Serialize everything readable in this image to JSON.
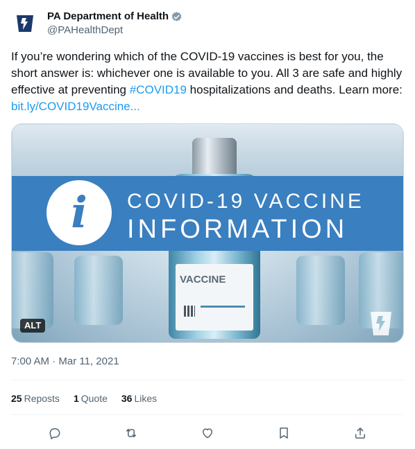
{
  "author": {
    "display_name": "PA Department of Health",
    "handle": "@PAHealthDept",
    "verified": true
  },
  "tweet": {
    "text_before": "If you’re wondering which of the COVID-19 vaccines is best for you, the short answer is: whichever one is available to you. All 3 are safe and highly effective at preventing ",
    "hashtag": "#COVID19",
    "text_after": " hospitalizations and deaths. Learn more: ",
    "link": "bit.ly/COVID19Vaccine..."
  },
  "media": {
    "banner_line1": "COVID-19 VACCINE",
    "banner_line2": "INFORMATION",
    "bottle_label": "VACCINE",
    "alt_badge": "ALT",
    "banner_color": "#3a7fbf"
  },
  "timestamp": "7:00 AM · Mar 11, 2021",
  "stats": {
    "reposts_count": "25",
    "reposts_label": "Reposts",
    "quotes_count": "1",
    "quotes_label": "Quote",
    "likes_count": "36",
    "likes_label": "Likes"
  },
  "actions": [
    "reply-icon",
    "repost-icon",
    "like-icon",
    "bookmark-icon",
    "share-icon"
  ],
  "colors": {
    "link": "#1d9bf0",
    "muted": "#536471",
    "text": "#0f1419"
  }
}
